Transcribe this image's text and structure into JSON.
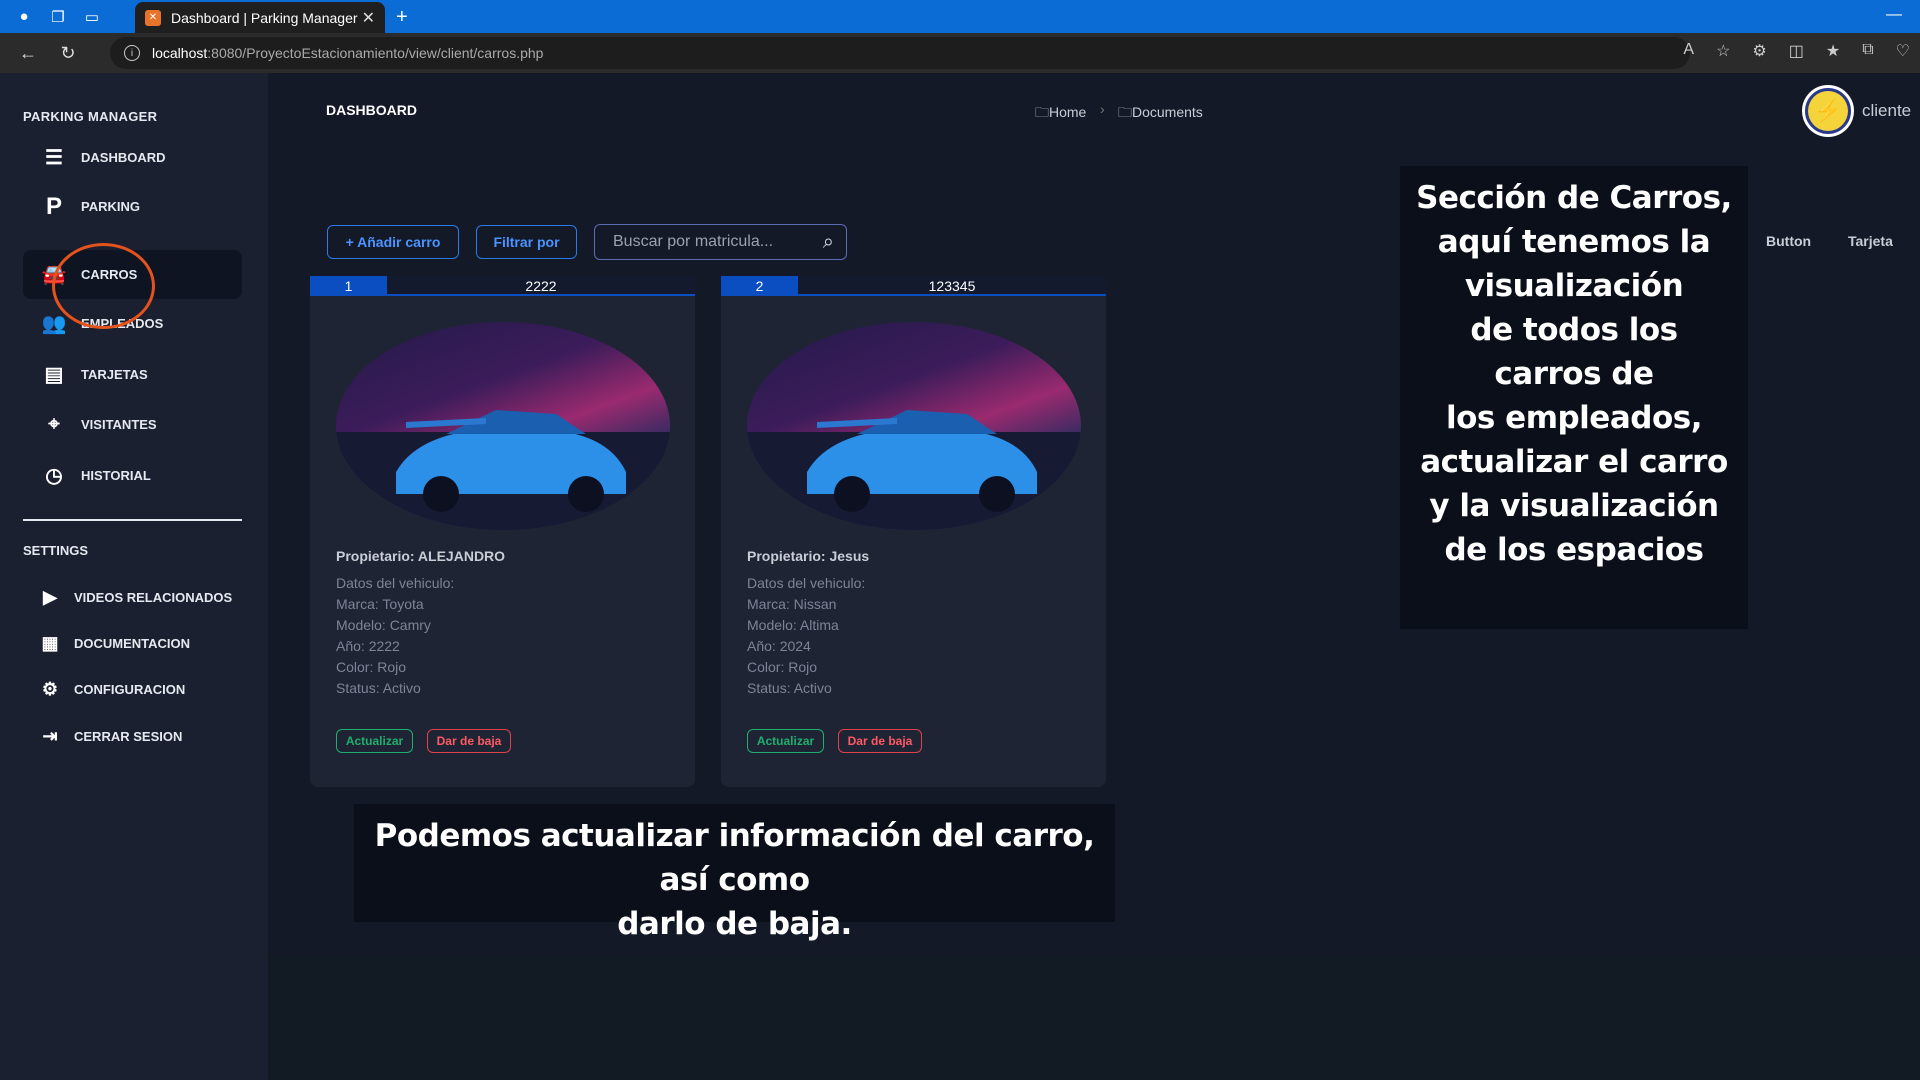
{
  "browser": {
    "tab_title": "Dashboard | Parking Manager",
    "url_host": "localhost",
    "url_rest": ":8080/ProyectoEstacionamiento/view/client/carros.php"
  },
  "sidebar": {
    "brand": "PARKING MANAGER",
    "items": [
      {
        "label": "DASHBOARD",
        "icon": "menu-icon"
      },
      {
        "label": "PARKING",
        "icon": "parking-icon"
      },
      {
        "label": "CARROS",
        "icon": "car-icon"
      },
      {
        "label": "EMPLEADOS",
        "icon": "employees-icon"
      },
      {
        "label": "TARJETAS",
        "icon": "card-icon"
      },
      {
        "label": "VISITANTES",
        "icon": "visitors-icon"
      },
      {
        "label": "HISTORIAL",
        "icon": "history-icon"
      }
    ],
    "settings_title": "SETTINGS",
    "settings_items": [
      {
        "label": "VIDEOS RELACIONADOS",
        "icon": "play-icon"
      },
      {
        "label": "DOCUMENTACION",
        "icon": "document-icon"
      },
      {
        "label": "CONFIGURACION",
        "icon": "gears-icon"
      },
      {
        "label": "CERRAR SESION",
        "icon": "logout-icon"
      }
    ]
  },
  "header": {
    "title": "DASHBOARD",
    "breadcrumb_home": "Home",
    "breadcrumb_docs": "Documents",
    "user": "cliente"
  },
  "toolbar": {
    "add_label": "+ Añadir carro",
    "filter_label": "Filtrar por",
    "search_placeholder": "Buscar por matricula...",
    "link_button": "Button",
    "link_tarjeta": "Tarjeta"
  },
  "cars": [
    {
      "index": "1",
      "plate": "2222",
      "owner": "Propietario: ALEJANDRO",
      "details": [
        "Datos del vehiculo:",
        "Marca: Toyota",
        "Modelo: Camry",
        "Año: 2222",
        "Color: Rojo",
        "Status: Activo"
      ]
    },
    {
      "index": "2",
      "plate": "123345",
      "owner": "Propietario: Jesus",
      "details": [
        "Datos del vehiculo:",
        "Marca: Nissan",
        "Modelo: Altima",
        "Año: 2024",
        "Color: Rojo",
        "Status: Activo"
      ]
    }
  ],
  "card_actions": {
    "update": "Actualizar",
    "delete": "Dar de baja"
  },
  "annotations": {
    "side": [
      "Sección de Carros,",
      "aquí tenemos la",
      "visualización",
      "de todos los",
      "carros de",
      "los empleados,",
      "actualizar el carro",
      "y la visualización",
      "de los espacios"
    ],
    "bottom": [
      "Podemos actualizar información del carro, así como",
      "darlo de baja."
    ]
  }
}
